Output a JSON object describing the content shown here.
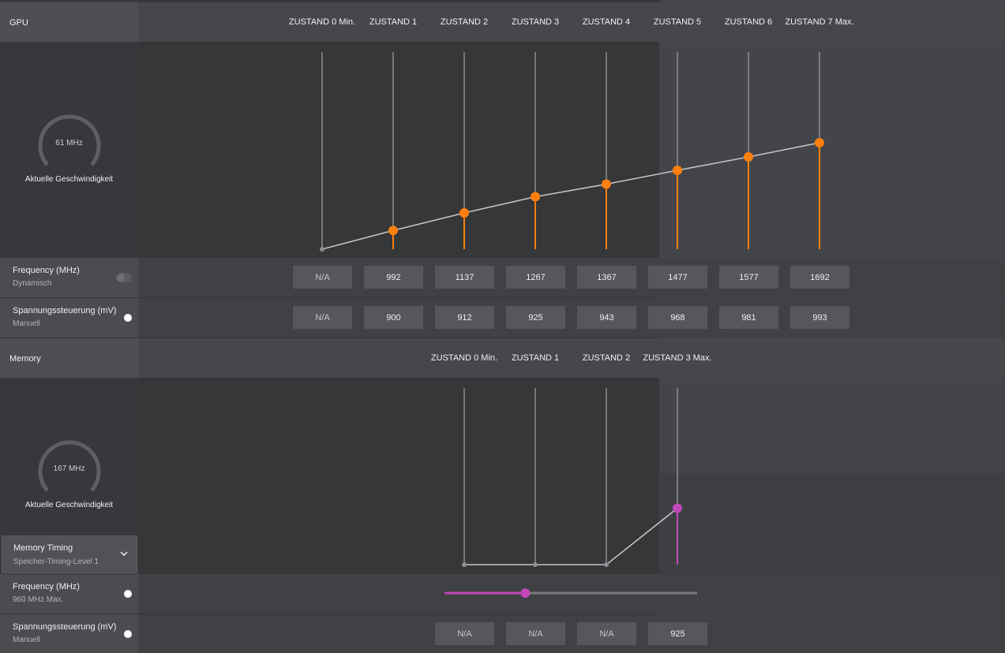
{
  "gpu": {
    "section_title": "GPU",
    "states": [
      "ZUSTAND 0 Min.",
      "ZUSTAND 1",
      "ZUSTAND 2",
      "ZUSTAND 3",
      "ZUSTAND 4",
      "ZUSTAND 5",
      "ZUSTAND 6",
      "ZUSTAND 7 Max."
    ],
    "gauge": {
      "value": "61 MHz",
      "label": "Aktuelle Geschwindigkeit"
    },
    "frequency": {
      "label": "Frequency (MHz)",
      "sublabel": "Dynamisch",
      "toggle": "off",
      "values": [
        "N/A",
        "992",
        "1137",
        "1267",
        "1367",
        "1477",
        "1577",
        "1692"
      ]
    },
    "voltage": {
      "label": "Spannungssteuerung (mV)",
      "sublabel": "Manuell",
      "toggle": "on",
      "values": [
        "N/A",
        "900",
        "912",
        "925",
        "943",
        "968",
        "981",
        "993"
      ]
    },
    "curve_levels": [
      0,
      0.095,
      0.184,
      0.266,
      0.33,
      0.4,
      0.468,
      0.54
    ],
    "accent": "#ff7f0e"
  },
  "memory": {
    "section_title": "Memory",
    "states": [
      "ZUSTAND 0 Min.",
      "ZUSTAND 1",
      "ZUSTAND 2",
      "ZUSTAND 3 Max."
    ],
    "gauge": {
      "value": "167 MHz",
      "label": "Aktuelle Geschwindigkeit"
    },
    "timing": {
      "label": "Memory Timing",
      "value": "Speicher-Timing-Level 1"
    },
    "frequency": {
      "label": "Frequency (MHz)",
      "sublabel": "960 MHz Max.",
      "toggle": "on",
      "slider_fraction": 0.32
    },
    "voltage": {
      "label": "Spannungssteuerung (mV)",
      "sublabel": "Manuell",
      "toggle": "on",
      "values": [
        "N/A",
        "N/A",
        "N/A",
        "925"
      ]
    },
    "curve_levels": [
      0,
      0,
      0,
      0.32
    ],
    "accent": "#c048b8"
  },
  "icons": [
    "chevron-down-icon",
    "gauge-icon",
    "toggle-switch"
  ]
}
